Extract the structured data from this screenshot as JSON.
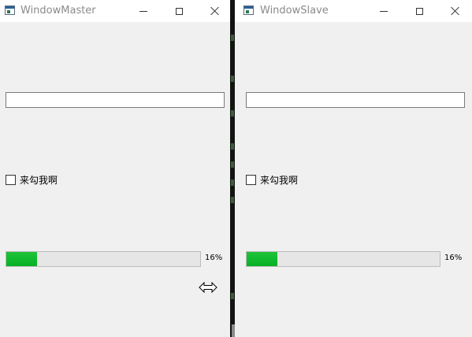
{
  "windows": [
    {
      "title": "WindowMaster",
      "input_value": "",
      "checkbox_label": "来勾我啊",
      "checkbox_checked": false,
      "progress_value": 0.16,
      "progress_text": "16%"
    },
    {
      "title": "WindowSlave",
      "input_value": "",
      "checkbox_label": "来勾我啊",
      "checkbox_checked": false,
      "progress_value": 0.16,
      "progress_text": "16%"
    }
  ],
  "title_buttons": [
    "minimize-icon",
    "maximize-icon",
    "close-icon"
  ],
  "cursor_icon": "resize-horizontal-cursor-icon",
  "colors": {
    "progress_fill": "#06b025",
    "window_bg": "#f0f0f0",
    "titlebar_bg": "#ffffff",
    "title_text": "#8b8b8b"
  }
}
